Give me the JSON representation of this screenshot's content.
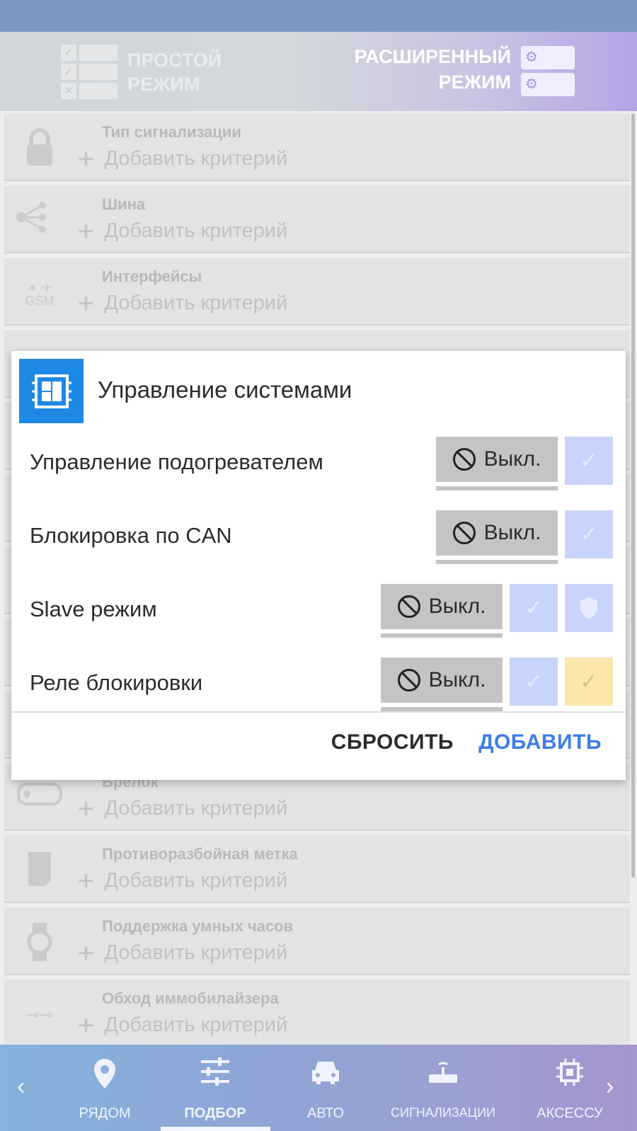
{
  "mode_header": {
    "simple_mode": {
      "line1": "ПРОСТОЙ",
      "line2": "РЕЖИМ"
    },
    "extended_mode": {
      "line1": "РАСШИРЕННЫЙ",
      "line2": "РЕЖИМ"
    }
  },
  "criteria": [
    {
      "title": "Тип сигнализации",
      "add_label": "Добавить критерий",
      "icon": "lock-icon"
    },
    {
      "title": "Шина",
      "add_label": "Добавить критерий",
      "icon": "bus-share-icon"
    },
    {
      "title": "Интерфейсы",
      "add_label": "Добавить критерий",
      "icon": "gsm-satellite-icon"
    },
    {
      "title": "Брелок",
      "add_label": "Добавить критерий",
      "icon": "key-fob-icon"
    },
    {
      "title": "Противоразбойная метка",
      "add_label": "Добавить критерий",
      "icon": "tag-icon"
    },
    {
      "title": "Поддержка умных часов",
      "add_label": "Добавить критерий",
      "icon": "watch-icon"
    },
    {
      "title": "Обход иммобилайзера",
      "add_label": "Добавить критерий",
      "icon": "immobilizer-icon"
    }
  ],
  "dialog": {
    "title": "Управление системами",
    "icon": "module-icon",
    "rows": [
      {
        "label": "Управление подогревателем",
        "off_label": "Выкл."
      },
      {
        "label": "Блокировка по CAN",
        "off_label": "Выкл."
      },
      {
        "label": "Slave режим",
        "off_label": "Выкл."
      },
      {
        "label": "Реле блокировки",
        "off_label": "Выкл."
      }
    ],
    "reset_label": "СБРОСИТЬ",
    "add_label": "ДОБАВИТЬ"
  },
  "bottom_nav": {
    "items": [
      {
        "label": "РЯДОМ",
        "icon": "location-pin-icon"
      },
      {
        "label": "ПОДБОР",
        "icon": "sliders-icon",
        "active": true
      },
      {
        "label": "АВТО",
        "icon": "car-icon"
      },
      {
        "label": "СИГНАЛИЗАЦИИ",
        "icon": "router-icon"
      },
      {
        "label": "АКСЕССУ",
        "icon": "chip-icon"
      }
    ]
  },
  "colors": {
    "accent_blue": "#1e88e5",
    "action_blue": "#3d7de6",
    "toggle_blue": "#c8d4fb",
    "toggle_yellow": "#fbe6ac",
    "off_grey": "#c4c4c4"
  }
}
